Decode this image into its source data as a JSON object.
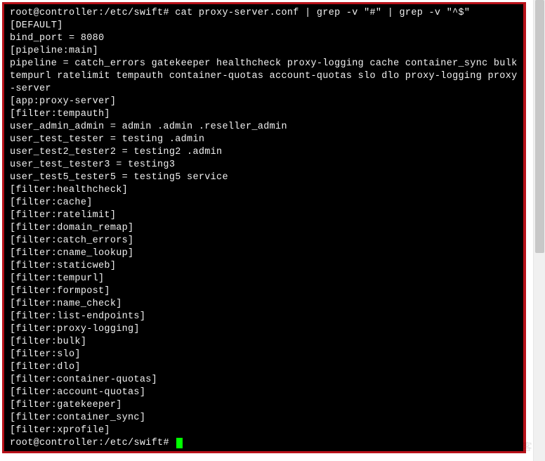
{
  "prompt": {
    "user_host": "root@controller",
    "cwd": "/etc/swift",
    "symbol": "#",
    "command": "cat proxy-server.conf | grep -v \"#\" | grep -v \"^$\""
  },
  "output_lines": [
    "[DEFAULT]",
    "bind_port = 8080",
    "[pipeline:main]",
    "pipeline = catch_errors gatekeeper healthcheck proxy-logging cache container_sync bulk tempurl ratelimit tempauth container-quotas account-quotas slo dlo proxy-logging proxy-server",
    "[app:proxy-server]",
    "[filter:tempauth]",
    "user_admin_admin = admin .admin .reseller_admin",
    "user_test_tester = testing .admin",
    "user_test2_tester2 = testing2 .admin",
    "user_test_tester3 = testing3",
    "user_test5_tester5 = testing5 service",
    "[filter:healthcheck]",
    "[filter:cache]",
    "[filter:ratelimit]",
    "[filter:domain_remap]",
    "[filter:catch_errors]",
    "[filter:cname_lookup]",
    "[filter:staticweb]",
    "[filter:tempurl]",
    "[filter:formpost]",
    "[filter:name_check]",
    "[filter:list-endpoints]",
    "[filter:proxy-logging]",
    "[filter:bulk]",
    "[filter:slo]",
    "[filter:dlo]",
    "[filter:container-quotas]",
    "[filter:account-quotas]",
    "[filter:gatekeeper]",
    "[filter:container_sync]",
    "[filter:xprofile]"
  ],
  "prompt2": {
    "user_host": "root@controller",
    "cwd": "/etc/swift",
    "symbol": "#"
  },
  "watermark": "©51CTO博客"
}
